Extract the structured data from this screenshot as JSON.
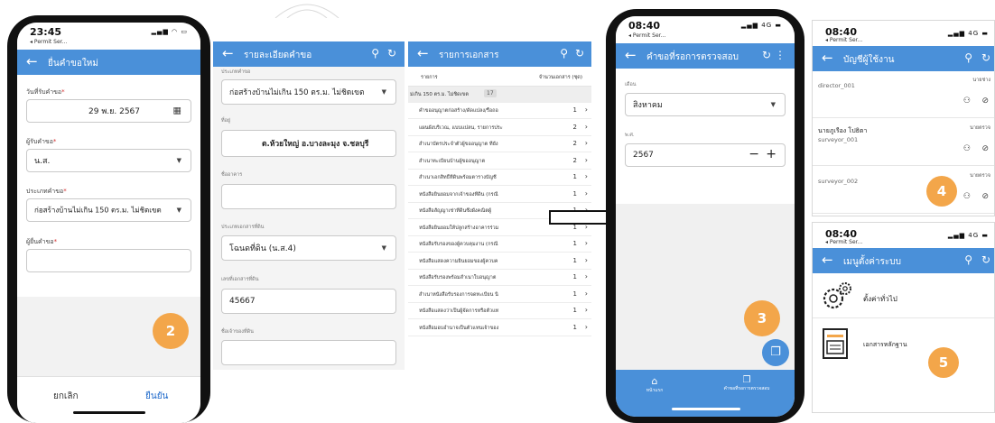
{
  "step_badges": [
    "2",
    "3",
    "4",
    "5"
  ],
  "colors": {
    "app_bar": "#4a90d9",
    "badge": "#f3a64a",
    "frame": "#111111",
    "accent_link": "#1a66c9"
  },
  "phone1": {
    "time": "23:45",
    "carrier": "Permit Ser...",
    "title": "ยื่นคำขอใหม่",
    "date_label": "วันที่รับคำขอ",
    "date_value": "29 พ.ย. 2567",
    "receiver_label": "ผู้รับคำขอ",
    "receiver_value": "น.ส.",
    "type_label": "ประเภทคำขอ",
    "type_value": "ก่อสร้างบ้านไม่เกิน 150 ตร.ม. ไม่ชิดเขต",
    "applicant_label": "ผู้ยื่นคำขอ",
    "applicant_value": "",
    "cancel": "ยกเลิก",
    "confirm": "ยืนยัน"
  },
  "screen_detail": {
    "title": "รายละเอียดคำขอ",
    "type_label": "ประเภทคำขอ",
    "type_value": "ก่อสร้างบ้านไม่เกิน 150 ตร.ม. ไม่ชิดเขต",
    "address_label": "ที่อยู่",
    "address_value": "ต.ห้วยใหญ่ อ.บางละมุง จ.ชลบุรี",
    "building_label": "ชื่ออาคาร",
    "building_value": "",
    "deed_type_label": "ประเภทเอกสารที่ดิน",
    "deed_type_value": "โฉนดที่ดิน (น.ส.4)",
    "deed_no_label": "เลขที่เอกสารที่ดิน",
    "deed_no_value": "45667",
    "owner_label": "ชื่อเจ้าของที่ดิน",
    "owner_value": ""
  },
  "screen_docs": {
    "title": "รายการเอกสาร",
    "col_item": "รายการ",
    "col_count": "จำนวนเอกสาร (ชุด)",
    "group_label": "ม่เกิน 150 ตร.ม. ไม่ชิดเขต",
    "group_count": "17",
    "rows": [
      {
        "name": "คำขออนุญาตก่อสร้าง/ดัดแปลง/รื้อถอ",
        "count": "1"
      },
      {
        "name": "แผนผังบริเวณ, แบบแปลน, รายการประ",
        "count": "2"
      },
      {
        "name": "สำเนาบัตรประจำตัวผู้ขออนุญาต ที่ยัง",
        "count": "2"
      },
      {
        "name": "สำเนาทะเบียนบ้านผู้ขออนุญาต",
        "count": "2"
      },
      {
        "name": "สำเนาเอกสิทธิ์ที่ดินพร้อมตารางบัญชี",
        "count": "1"
      },
      {
        "name": "หนังสือยินยอมจากเจ้าของที่ดิน (กรณี",
        "count": "1"
      },
      {
        "name": "หนังสือสัญญาเช่าที่ดินซึ่งผังคณิตผู้",
        "count": "1"
      },
      {
        "name": "หนังสือยินยอมให้ปลูกสร้างอาคารร่วม",
        "count": "1"
      },
      {
        "name": "หนังสือรับรองของผู้ควบคุมงาน (กรณี",
        "count": "1"
      },
      {
        "name": "หนังสือแสดงความยินยอมของผู้ควบค",
        "count": "1"
      },
      {
        "name": "หนังสือรับรองพร้อมสำเนาใบอนุญาต",
        "count": "1"
      },
      {
        "name": "สำเนาหนังสือรับรองการจดทะเบียน นิ",
        "count": "1"
      },
      {
        "name": "หนังสือแสดงว่าเป็นผู้จัดการหรือตัวแท",
        "count": "1"
      },
      {
        "name": "หนังสือมอบอำนาจเป็นตัวแทนเจ้าของ",
        "count": "1"
      }
    ]
  },
  "phone2": {
    "time": "08:40",
    "carrier": "Permit Ser...",
    "network": "4G",
    "title": "คำขอที่รอการตรวจสอบ",
    "month_label": "เดือน",
    "month_value": "สิงหาคม",
    "year_label": "พ.ศ.",
    "year_value": "2567",
    "nav_home": "หน้าแรก",
    "nav_pending": "คำขอที่รอการตรวจสอบ"
  },
  "panel_users": {
    "time": "08:40",
    "carrier": "Permit Ser...",
    "network": "4G",
    "title": "บัญชีผู้ใช้งาน",
    "users": [
      {
        "name": "",
        "id": "director_001",
        "role": "นายช่าง"
      },
      {
        "name": "นายภูเรือง โปธิตา",
        "id": "surveyor_001",
        "role": "นายตรวจ"
      },
      {
        "name": "",
        "id": "surveyor_002",
        "role": "นายตรวจ"
      }
    ]
  },
  "panel_settings": {
    "time": "08:40",
    "carrier": "Permit Ser...",
    "network": "4G",
    "title": "เมนูตั้งค่าระบบ",
    "items": [
      {
        "label": "ตั้งค่าทั่วไป",
        "icon": "gears-icon"
      },
      {
        "label": "เอกสารหลักฐาน",
        "icon": "document-icon"
      }
    ]
  }
}
